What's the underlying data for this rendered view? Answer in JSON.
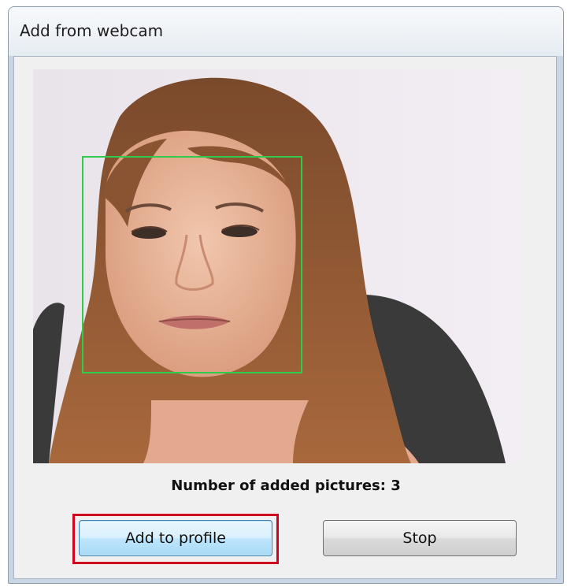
{
  "window": {
    "title": "Add from webcam"
  },
  "webcam": {
    "face_box_color": "#2ecc4a"
  },
  "status": {
    "text": "Number of added pictures: 3",
    "added_count": 3
  },
  "buttons": {
    "add_label": "Add to profile",
    "stop_label": "Stop"
  },
  "highlight_color": "#d0021b"
}
